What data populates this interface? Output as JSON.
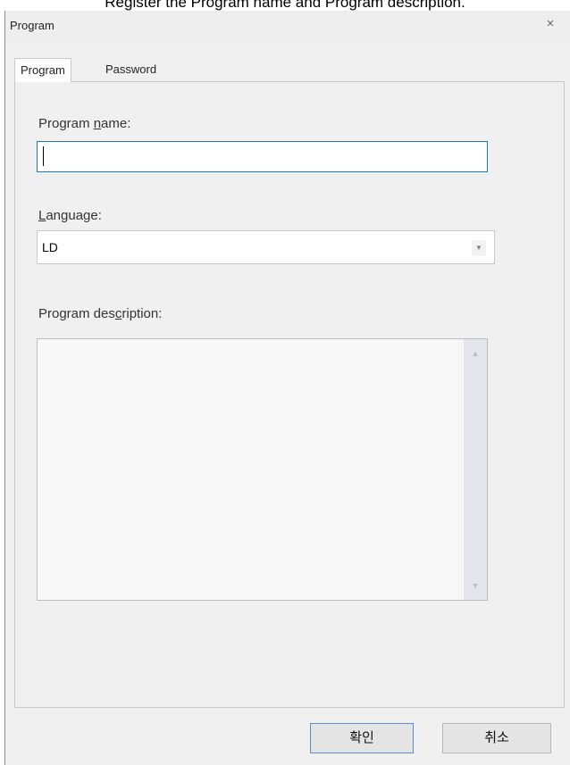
{
  "caption": "Register the Program name and Program description.",
  "dialog": {
    "title": "Program",
    "close_glyph": "×",
    "tabs": [
      {
        "label": "Program",
        "active": true
      },
      {
        "label": "Password",
        "active": false
      }
    ],
    "program_name": {
      "label_pre": "Program ",
      "label_accel": "n",
      "label_post": "ame:",
      "value": ""
    },
    "language": {
      "label_accel": "L",
      "label_post": "anguage:",
      "selected": "LD"
    },
    "description": {
      "label_pre": "Program des",
      "label_accel": "c",
      "label_post": "ription:",
      "value": ""
    },
    "buttons": {
      "ok": "확인",
      "cancel": "취소"
    }
  },
  "icons": {
    "close": "close-icon",
    "dropdown": "chevron-down-icon",
    "scroll_up": "scroll-up-icon",
    "scroll_down": "scroll-down-icon"
  },
  "colors": {
    "focus_border": "#1a7ad0",
    "dialog_bg": "#f0f0f0"
  }
}
